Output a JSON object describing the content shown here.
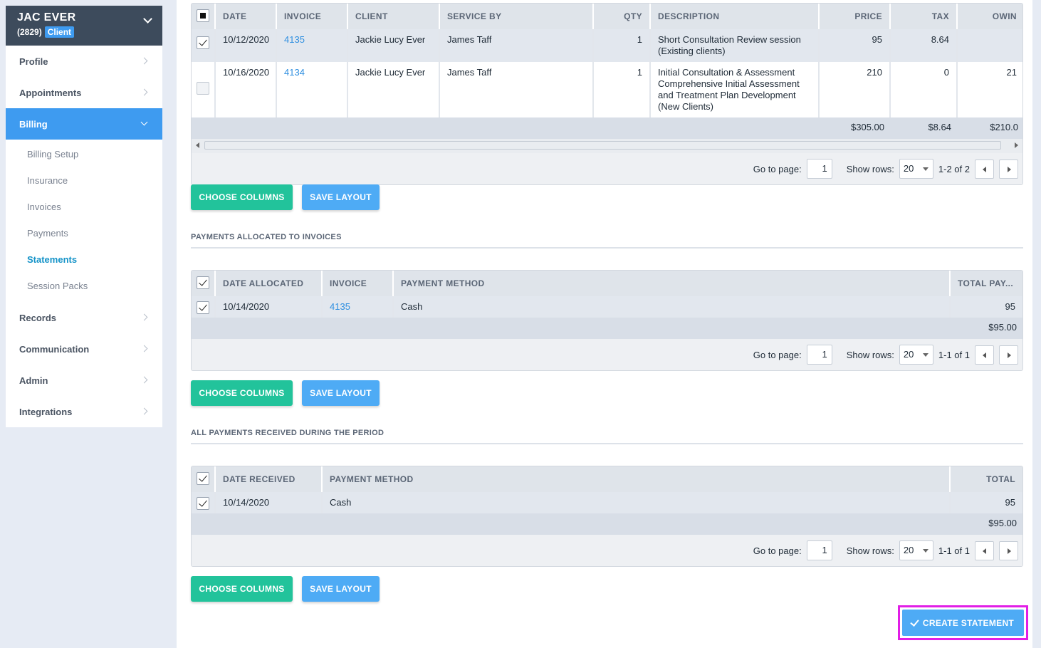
{
  "sidebar": {
    "client_name": "JAC EVER",
    "client_id": "(2829)",
    "client_badge": "Client",
    "nav": [
      {
        "label": "Profile"
      },
      {
        "label": "Appointments"
      },
      {
        "label": "Billing"
      },
      {
        "label": "Records"
      },
      {
        "label": "Communication"
      },
      {
        "label": "Admin"
      },
      {
        "label": "Integrations"
      }
    ],
    "billing_sub": [
      {
        "label": "Billing Setup"
      },
      {
        "label": "Insurance"
      },
      {
        "label": "Invoices"
      },
      {
        "label": "Payments"
      },
      {
        "label": "Statements"
      },
      {
        "label": "Session Packs"
      }
    ]
  },
  "invoices_grid": {
    "columns": [
      "DATE",
      "INVOICE",
      "CLIENT",
      "SERVICE BY",
      "QTY",
      "DESCRIPTION",
      "PRICE",
      "TAX",
      "OWIN"
    ],
    "rows": [
      {
        "date": "10/12/2020",
        "invoice": "4135",
        "client": "Jackie Lucy Ever",
        "service_by": "James Taff",
        "qty": "1",
        "description": "Short Consultation Review session (Existing clients)",
        "price": "95",
        "tax": "8.64",
        "owing": "",
        "checked": true
      },
      {
        "date": "10/16/2020",
        "invoice": "4134",
        "client": "Jackie Lucy Ever",
        "service_by": "James Taff",
        "qty": "1",
        "description": "Initial Consultation & Assessment Comprehensive Initial Assessment and Treatment Plan Development (New Clients)",
        "price": "210",
        "tax": "0",
        "owing": "21",
        "checked": false
      }
    ],
    "totals": {
      "price": "$305.00",
      "tax": "$8.64",
      "owing": "$210.0"
    },
    "pager": {
      "go_label": "Go to page:",
      "page": "1",
      "rows_label": "Show rows:",
      "rows": "20",
      "range": "1-2 of 2"
    }
  },
  "buttons": {
    "choose_columns": "CHOOSE COLUMNS",
    "save_layout": "SAVE LAYOUT",
    "create_statement": "CREATE STATEMENT"
  },
  "allocated": {
    "title": "PAYMENTS ALLOCATED TO INVOICES",
    "columns": [
      "DATE ALLOCATED",
      "INVOICE",
      "PAYMENT METHOD",
      "TOTAL PAY..."
    ],
    "rows": [
      {
        "date": "10/14/2020",
        "invoice": "4135",
        "method": "Cash",
        "total": "95",
        "checked": true
      }
    ],
    "total": "$95.00",
    "pager": {
      "go_label": "Go to page:",
      "page": "1",
      "rows_label": "Show rows:",
      "rows": "20",
      "range": "1-1 of 1"
    }
  },
  "received": {
    "title": "ALL PAYMENTS RECEIVED DURING THE PERIOD",
    "columns": [
      "DATE RECEIVED",
      "PAYMENT METHOD",
      "TOTAL"
    ],
    "rows": [
      {
        "date": "10/14/2020",
        "method": "Cash",
        "total": "95",
        "checked": true
      }
    ],
    "total": "$95.00",
    "pager": {
      "go_label": "Go to page:",
      "page": "1",
      "rows_label": "Show rows:",
      "rows": "20",
      "range": "1-1 of 1"
    }
  },
  "colors": {
    "accent": "#3e9bf0",
    "green": "#22c39b",
    "header_dark": "#3d4b5c",
    "highlight": "#e11ee6"
  }
}
